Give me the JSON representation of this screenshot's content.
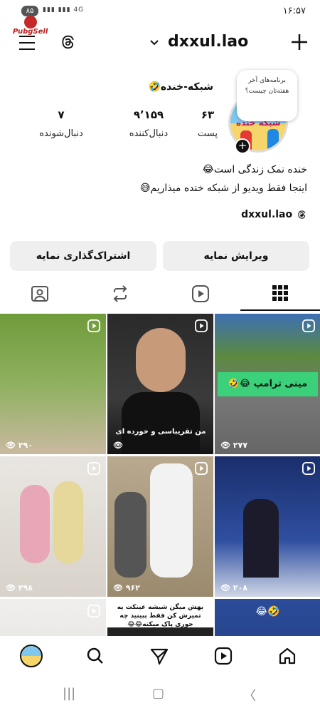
{
  "status_bar": {
    "time": "۱۶:۵۷",
    "battery": "۸۵",
    "network": "4G"
  },
  "watermark": "PubgSell",
  "header": {
    "username": "dxxul.lao"
  },
  "profile": {
    "display_name": "شبکه-خنده🤣",
    "story_bubble": "برنامه‌های آخر هفته‌تان چیست؟",
    "avatar_text": "شبکه خنده",
    "stats": [
      {
        "number": "۶۳",
        "label": "پست"
      },
      {
        "number": "۹٬۱۵۹",
        "label": "دنبال‌کننده"
      },
      {
        "number": "۷",
        "label": "دنبال‌شونده"
      }
    ],
    "bio": [
      "خنده نمک زندگی است😂",
      "اینجا فقط ویدیو از شبکه خنده میذاریم😅"
    ],
    "threads_handle": "dxxul.lao"
  },
  "buttons": {
    "edit": "ویرایش نمایه",
    "share": "اشتراک‌گذاری نمایه"
  },
  "tabs": [
    "grid-icon",
    "reels-icon",
    "reposts-icon",
    "tagged-icon"
  ],
  "posts": [
    {
      "views": "۲۹۰",
      "caption": ""
    },
    {
      "views": "",
      "caption": "من تقریباسی و خورده ای"
    },
    {
      "views": "۲۷۷",
      "caption": "مینی ترامپ 😂🤣"
    },
    {
      "views": "۲۹۸",
      "caption": ""
    },
    {
      "views": "۹۶۲",
      "caption": ""
    },
    {
      "views": "۲۰۸",
      "caption": ""
    },
    {
      "views": "",
      "caption": ""
    },
    {
      "views": "",
      "caption": "بهش میگن شیشه عینکت یه تمیزش کن فقط ببینید چه جوری پاک میکنه😂😂"
    },
    {
      "views": "",
      "caption": "🤣😂"
    }
  ],
  "colors": {
    "accent": "#111111",
    "button_bg": "#efefef",
    "caption_green": "#3ad17a"
  }
}
